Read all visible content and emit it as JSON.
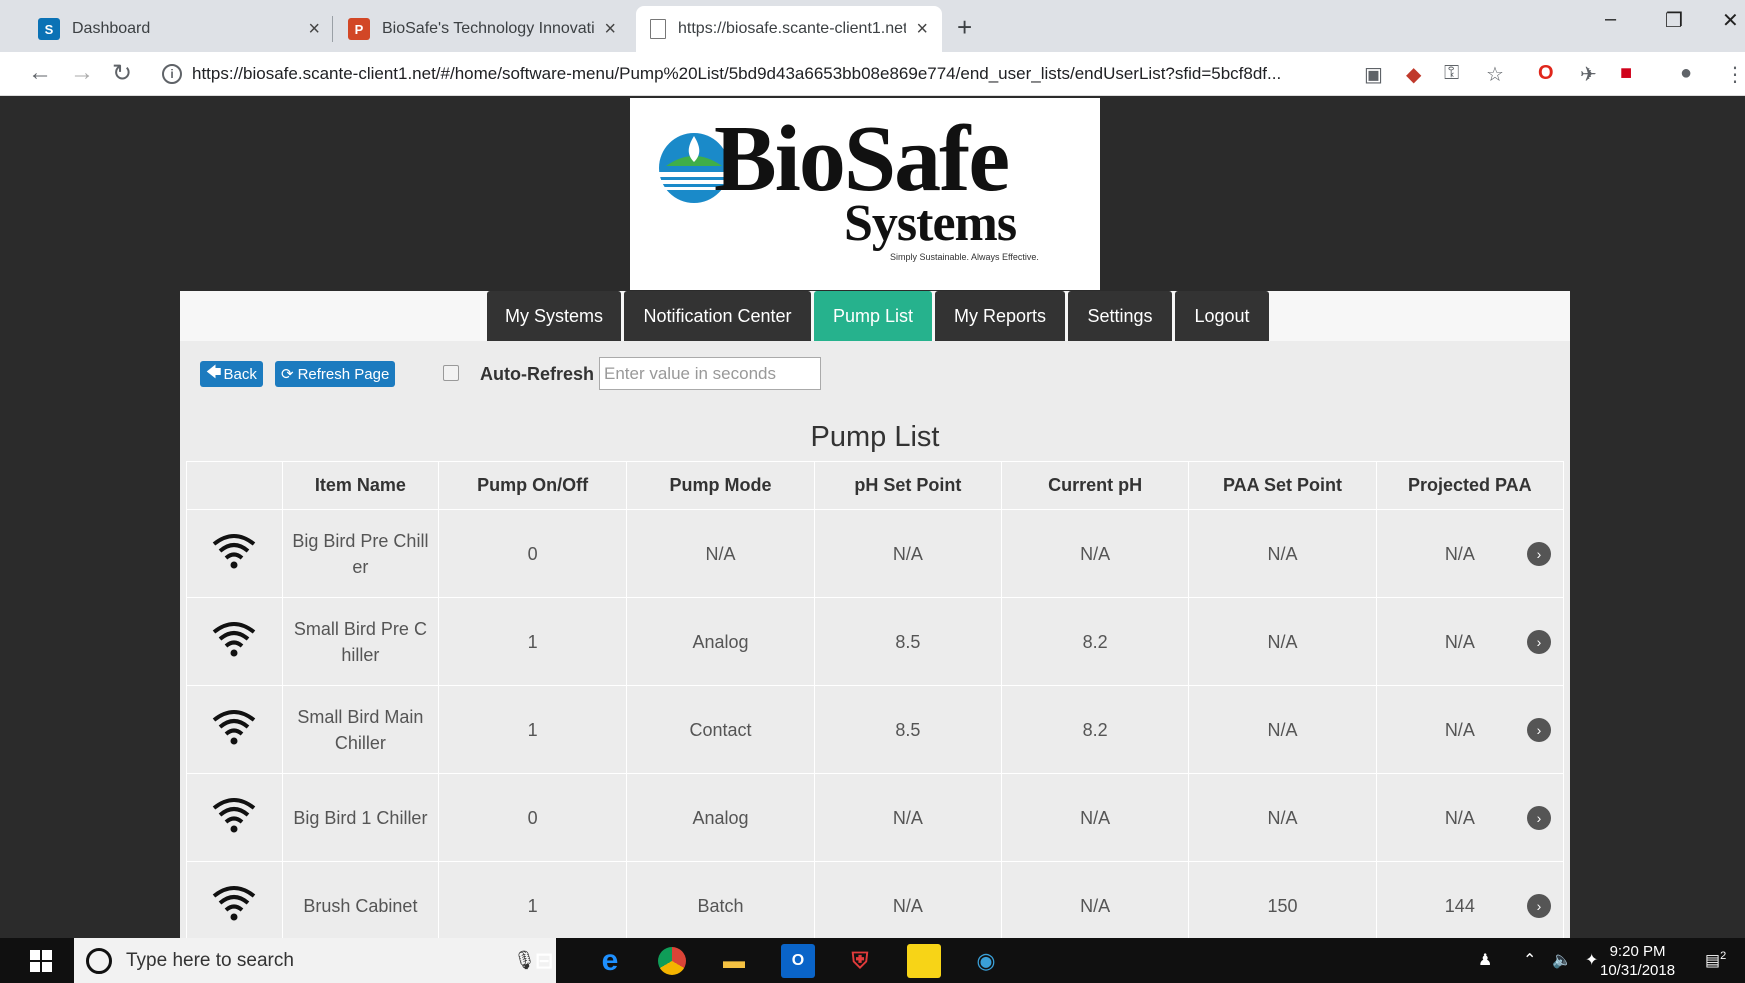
{
  "browser": {
    "tabs": [
      {
        "title": "Dashboard",
        "icon": "sharepoint-icon",
        "active": false
      },
      {
        "title": "BioSafe's Technology Innovation",
        "icon": "powerpoint-icon",
        "active": false
      },
      {
        "title": "https://biosafe.scante-client1.net",
        "icon": "page-icon",
        "active": true
      }
    ],
    "url": "https://biosafe.scante-client1.net/#/home/software-menu/Pump%20List/5bd9d43a6653bb08e869e774/end_user_lists/endUserList?sfid=5bcf8df..."
  },
  "logo": {
    "word": "BioSafe",
    "sub": "Systems",
    "tagline": "Simply Sustainable. Always Effective."
  },
  "nav": {
    "items": [
      "My Systems",
      "Notification Center",
      "Pump List",
      "My Reports",
      "Settings",
      "Logout"
    ],
    "active": "Pump List"
  },
  "controls": {
    "back": "Back",
    "refresh": "Refresh Page",
    "auto_refresh_label": "Auto-Refresh",
    "auto_refresh_placeholder": "Enter value in seconds"
  },
  "list_title": "Pump List",
  "table": {
    "headers": [
      "",
      "Item Name",
      "Pump On/Off",
      "Pump Mode",
      "pH Set Point",
      "Current pH",
      "PAA Set Point",
      "Projected PAA"
    ],
    "rows": [
      {
        "name": "Big Bird Pre Chiller",
        "on_off": "0",
        "mode": "N/A",
        "ph_set": "N/A",
        "ph_cur": "N/A",
        "paa_set": "N/A",
        "paa_proj": "N/A"
      },
      {
        "name": "Small Bird Pre Chiller",
        "on_off": "1",
        "mode": "Analog",
        "ph_set": "8.5",
        "ph_cur": "8.2",
        "paa_set": "N/A",
        "paa_proj": "N/A"
      },
      {
        "name": "Small Bird Main Chiller",
        "on_off": "1",
        "mode": "Contact",
        "ph_set": "8.5",
        "ph_cur": "8.2",
        "paa_set": "N/A",
        "paa_proj": "N/A"
      },
      {
        "name": "Big Bird 1 Chiller",
        "on_off": "0",
        "mode": "Analog",
        "ph_set": "N/A",
        "ph_cur": "N/A",
        "paa_set": "N/A",
        "paa_proj": "N/A"
      },
      {
        "name": "Brush Cabinet",
        "on_off": "1",
        "mode": "Batch",
        "ph_set": "N/A",
        "ph_cur": "N/A",
        "paa_set": "150",
        "paa_proj": "144"
      }
    ]
  },
  "taskbar": {
    "search_placeholder": "Type here to search",
    "time": "9:20 PM",
    "date": "10/31/2018",
    "notifications": "2"
  }
}
